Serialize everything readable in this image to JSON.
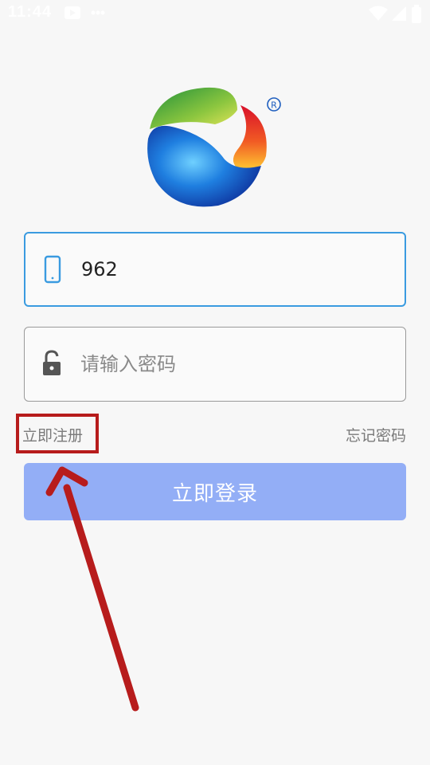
{
  "status_bar": {
    "time": "11:44"
  },
  "login_form": {
    "phone_value": "962",
    "password_placeholder": "请输入密码",
    "register_label": "立即注册",
    "forgot_label": "忘记密码",
    "login_label": "立即登录"
  },
  "colors": {
    "focus_border": "#3a9be0",
    "login_button": "#93aef6",
    "annotation_red": "#b71c1c"
  },
  "icons": {
    "phone": "phone-icon",
    "lock": "unlock-icon",
    "logo": "brand-logo"
  }
}
